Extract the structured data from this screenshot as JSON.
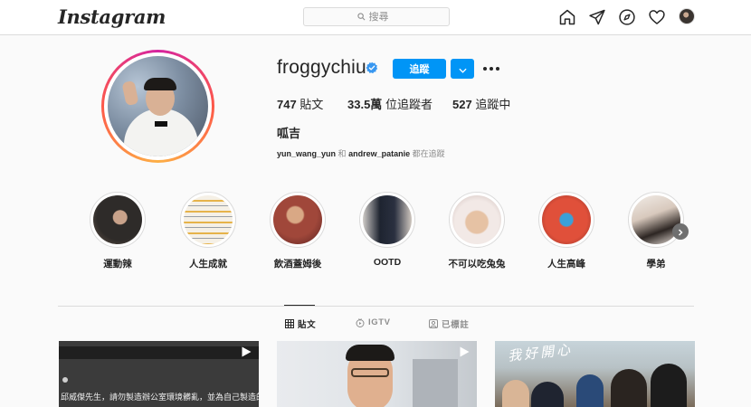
{
  "nav": {
    "logo": "Instagram",
    "search_placeholder": "搜尋",
    "icons": [
      "home-icon",
      "direct-icon",
      "explore-icon",
      "activity-heart-icon",
      "profile-avatar"
    ]
  },
  "profile": {
    "username": "froggychiu",
    "verified": true,
    "follow_label": "追蹤",
    "stats": {
      "posts_count": "747",
      "posts_label": "貼文",
      "followers_count": "33.5萬",
      "followers_label": "位追蹤者",
      "following_count": "527",
      "following_label": "追蹤中"
    },
    "full_name": "呱吉",
    "followed_by": {
      "user1": "yun_wang_yun",
      "and": "和",
      "user2": "andrew_patanie",
      "suffix": "都在追蹤"
    }
  },
  "highlights": [
    {
      "label": "運動辣"
    },
    {
      "label": "人生成就"
    },
    {
      "label": "飲酒蓋姆後"
    },
    {
      "label": "OOTD"
    },
    {
      "label": "不可以吃兔兔"
    },
    {
      "label": "人生高峰"
    },
    {
      "label": "學弟"
    }
  ],
  "tabs": [
    {
      "label": "貼文",
      "active": true
    },
    {
      "label": "IGTV",
      "active": false
    },
    {
      "label": "已標註",
      "active": false
    }
  ],
  "posts": [
    {
      "type": "video",
      "caption": "邱威傑先生，請勿製造辦公室環境髒亂，並為自己製造的髒"
    },
    {
      "type": "video"
    },
    {
      "type": "photo",
      "overlay_text": "我好開心"
    }
  ],
  "colors": {
    "accent": "#0095f6",
    "border": "#dbdbdb",
    "text": "#262626",
    "muted": "#8e8e8e",
    "background": "#fafafa"
  }
}
